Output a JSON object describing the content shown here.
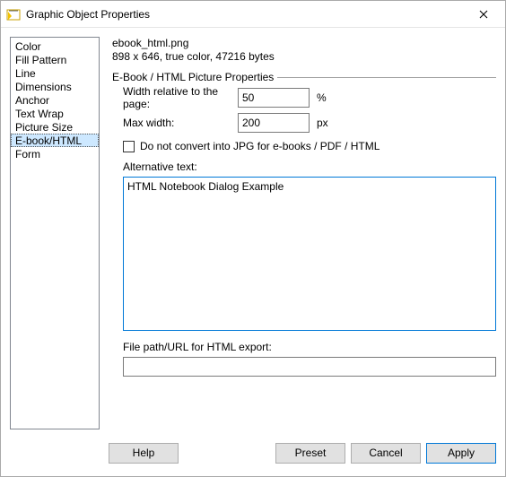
{
  "window": {
    "title": "Graphic Object Properties"
  },
  "sidebar": {
    "items": [
      {
        "label": "Color"
      },
      {
        "label": "Fill Pattern"
      },
      {
        "label": "Line"
      },
      {
        "label": "Dimensions"
      },
      {
        "label": "Anchor"
      },
      {
        "label": "Text Wrap"
      },
      {
        "label": "Picture Size"
      },
      {
        "label": "E-book/HTML"
      },
      {
        "label": "Form"
      }
    ],
    "selected_index": 7
  },
  "file": {
    "name": "ebook_html.png",
    "details": "898 x 646, true color, 47216 bytes"
  },
  "group": {
    "title": "E-Book / HTML Picture Properties",
    "width_label": "Width relative to the page:",
    "width_value": "50",
    "width_unit": "%",
    "maxwidth_label": "Max width:",
    "maxwidth_value": "200",
    "maxwidth_unit": "px",
    "convert_label": "Do not convert into JPG for e-books / PDF / HTML",
    "convert_checked": false,
    "alt_label": "Alternative text:",
    "alt_value": "HTML Notebook Dialog Example",
    "path_label": "File path/URL for HTML export:",
    "path_value": ""
  },
  "buttons": {
    "help": "Help",
    "preset": "Preset",
    "cancel": "Cancel",
    "apply": "Apply"
  }
}
